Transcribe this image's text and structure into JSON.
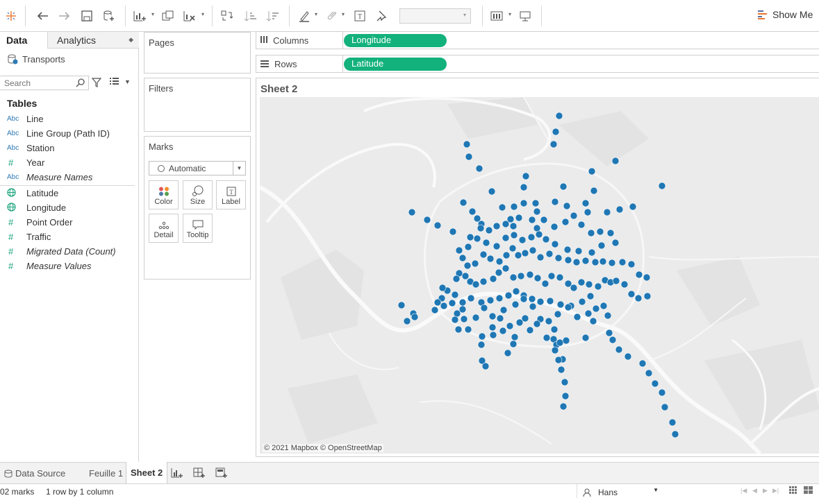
{
  "toolbar": {
    "show_me_label": "Show Me",
    "icons": [
      "tableau-logo-icon",
      "undo-icon",
      "redo-icon",
      "save-icon",
      "new-datasource-icon",
      "new-worksheet-icon",
      "duplicate-icon",
      "clear-sheet-icon",
      "swap-icon",
      "sort-ascending-icon",
      "sort-descending-icon",
      "highlight-icon",
      "group-icon",
      "label-icon",
      "pin-icon",
      "fit-icon",
      "presentation-icon"
    ]
  },
  "data_pane": {
    "tab_data": "Data",
    "tab_analytics": "Analytics",
    "datasource": "Transports",
    "search_placeholder": "Search",
    "tables_heading": "Tables",
    "dimensions": [
      {
        "type": "Abc",
        "name": "Line"
      },
      {
        "type": "Abc",
        "name": "Line Group (Path ID)"
      },
      {
        "type": "Abc",
        "name": "Station"
      },
      {
        "type": "#",
        "name": "Year"
      },
      {
        "type": "Abc",
        "name": "Measure Names"
      }
    ],
    "measures": [
      {
        "type": "geo",
        "name": "Latitude"
      },
      {
        "type": "geo",
        "name": "Longitude"
      },
      {
        "type": "#",
        "name": "Point Order"
      },
      {
        "type": "#",
        "name": "Traffic"
      },
      {
        "type": "#",
        "name": "Migrated Data (Count)"
      },
      {
        "type": "#",
        "name": "Measure Values"
      }
    ]
  },
  "cards": {
    "pages": "Pages",
    "filters": "Filters",
    "marks": "Marks",
    "mark_type": "Automatic",
    "buttons": [
      "Color",
      "Size",
      "Label",
      "Detail",
      "Tooltip"
    ]
  },
  "shelves": {
    "columns_label": "Columns",
    "columns_pill": "Longitude",
    "rows_label": "Rows",
    "rows_pill": "Latitude"
  },
  "view": {
    "sheet_title": "Sheet 2",
    "attribution": "© 2021 Mapbox © OpenStreetMap",
    "mark_color": "#1f77b4"
  },
  "bottom": {
    "tabs": [
      "Data Source",
      "Feuille 1",
      "Sheet 2"
    ],
    "active_tab": "Sheet 2",
    "marks_count": "02 marks",
    "rows_cols": "1 row by 1 column",
    "user": "Hans"
  }
}
